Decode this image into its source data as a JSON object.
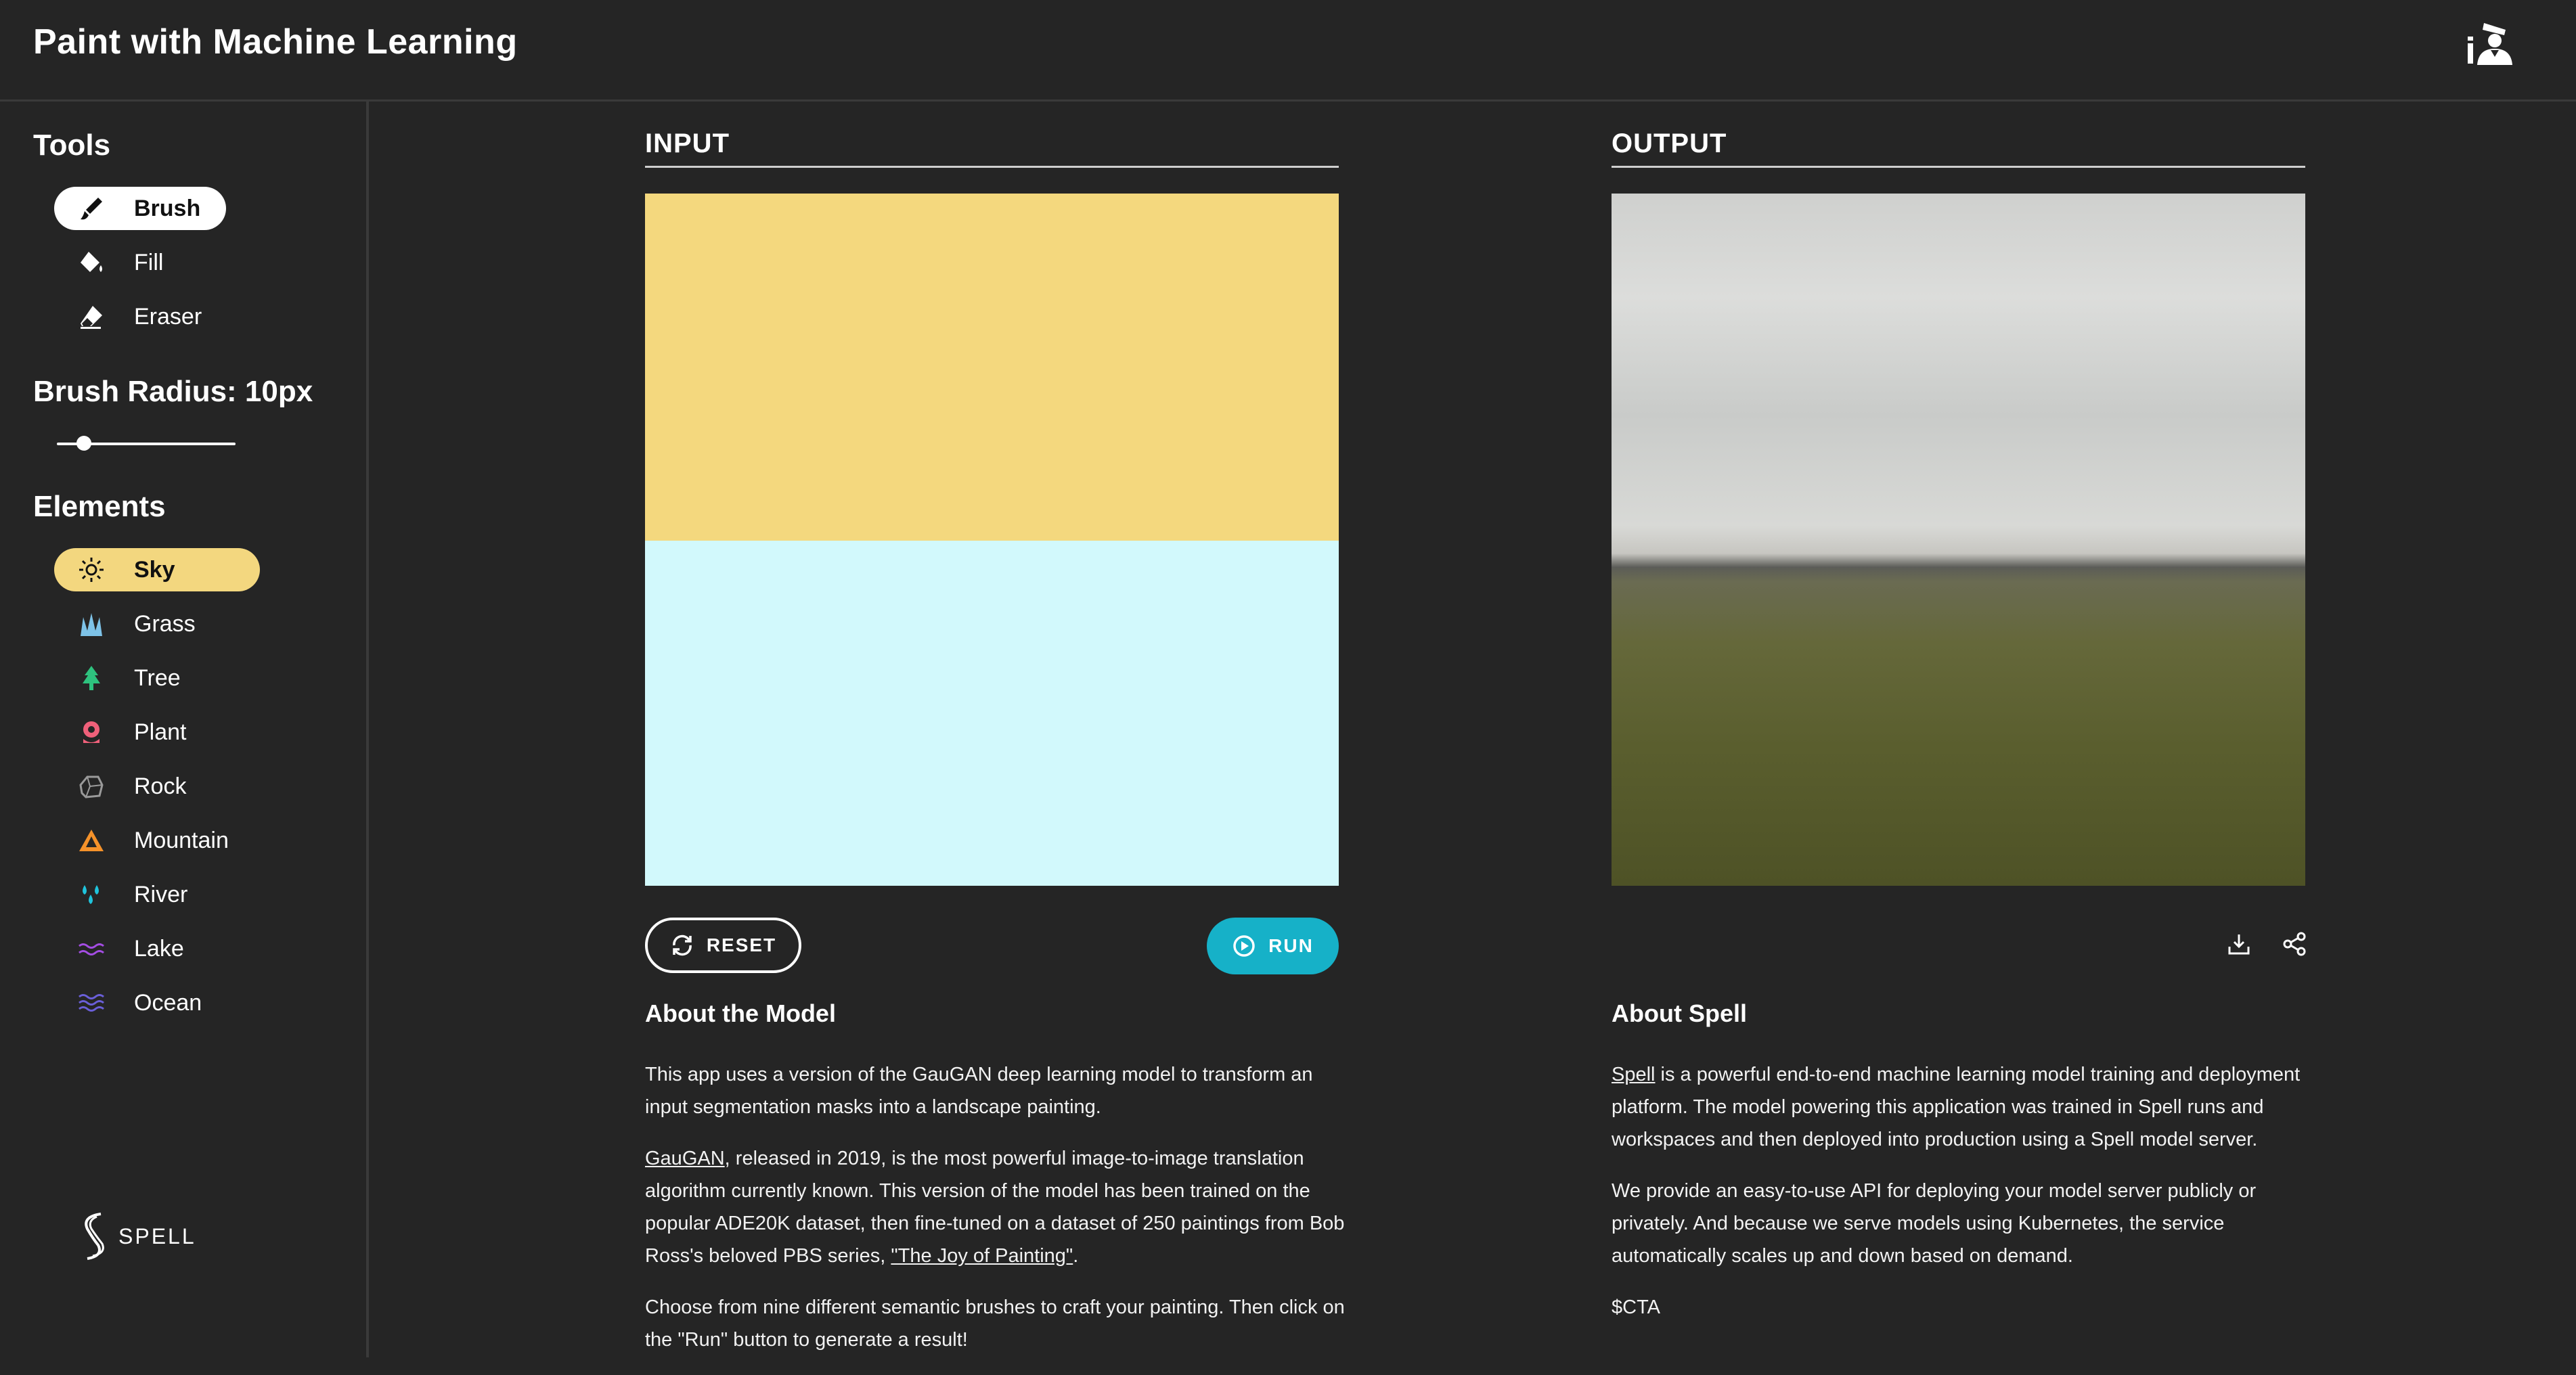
{
  "app": {
    "title": "Paint with Machine Learning"
  },
  "header": {
    "icon": "painter-avatar-icon"
  },
  "sidebar": {
    "tools_heading": "Tools",
    "tools": [
      {
        "label": "Brush",
        "icon": "brush-icon",
        "active": true
      },
      {
        "label": "Fill",
        "icon": "paint-bucket-icon",
        "active": false
      },
      {
        "label": "Eraser",
        "icon": "eraser-icon",
        "active": false
      }
    ],
    "brush_radius_label": "Brush Radius: 10px",
    "brush_radius_fraction": 0.16,
    "elements_heading": "Elements",
    "elements": [
      {
        "label": "Sky",
        "icon": "sun-icon",
        "color": "#f3d77f",
        "active": true
      },
      {
        "label": "Grass",
        "icon": "grass-icon",
        "color": "#7ec3e8"
      },
      {
        "label": "Tree",
        "icon": "tree-icon",
        "color": "#2ec27e"
      },
      {
        "label": "Plant",
        "icon": "flower-icon",
        "color": "#f0607a"
      },
      {
        "label": "Rock",
        "icon": "rock-icon",
        "color": "#9a9a9a"
      },
      {
        "label": "Mountain",
        "icon": "mountain-icon",
        "color": "#f5922a"
      },
      {
        "label": "River",
        "icon": "droplets-icon",
        "color": "#1fc4dc"
      },
      {
        "label": "Lake",
        "icon": "waves-icon",
        "color": "#a44de3"
      },
      {
        "label": "Ocean",
        "icon": "ocean-waves-icon",
        "color": "#6a5fd8"
      }
    ],
    "brand": "SPELL"
  },
  "input_panel": {
    "title": "INPUT",
    "canvas_colors": [
      "#f4d87e",
      "#d2f9fc"
    ],
    "reset_label": "RESET",
    "run_label": "RUN",
    "run_color": "#16b1c8"
  },
  "output_panel": {
    "title": "OUTPUT",
    "actions": [
      "download-icon",
      "share-icon"
    ]
  },
  "about_model": {
    "title": "About the Model",
    "p1": "This app uses a version of the GauGAN deep learning model to transform an input segmentation masks into a landscape painting.",
    "p2_link": "GauGAN",
    "p2_text": ", released in 2019, is the most powerful image-to-image translation algorithm currently known. This version of the model has been trained on the popular ADE20K dataset, then fine-tuned on a dataset of 250 paintings from Bob Ross's beloved PBS series, ",
    "p2_link2": "\"The Joy of Painting\"",
    "p2_end": ".",
    "p3": "Choose from nine different semantic brushes to craft your painting. Then click on the \"Run\" button to generate a result!"
  },
  "about_spell": {
    "title": "About Spell",
    "p1_link": "Spell",
    "p1_text": " is a powerful end-to-end machine learning model training and deployment platform. The model powering this application was trained in Spell runs and workspaces and then deployed into production using a Spell model server.",
    "p2": "We provide an easy-to-use API for deploying your model server publicly or privately. And because we serve models using Kubernetes, the service automatically scales up and down based on demand.",
    "p3": "$CTA"
  }
}
